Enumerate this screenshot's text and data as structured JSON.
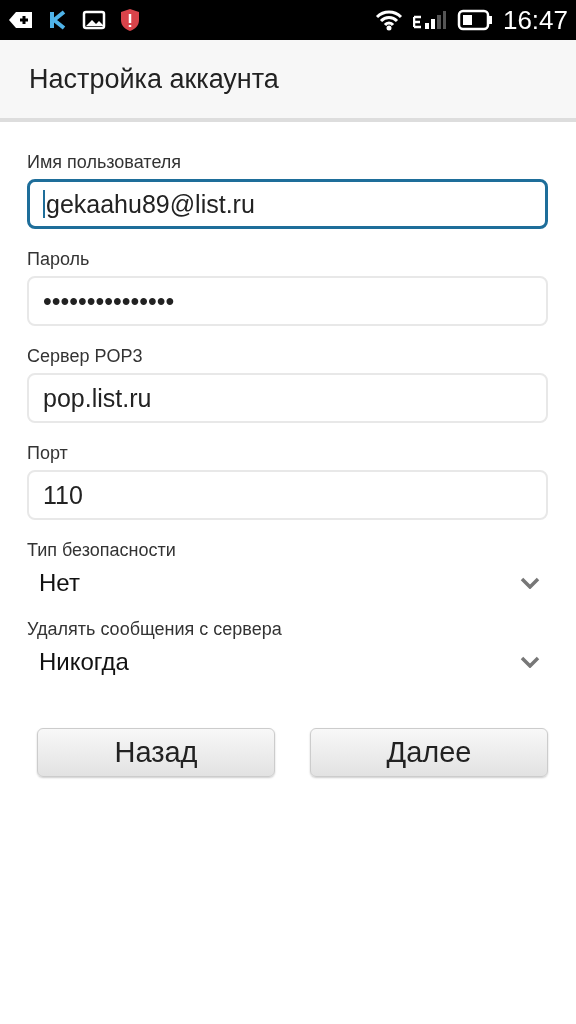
{
  "status_bar": {
    "time": "16:47"
  },
  "header": {
    "title": "Настройка аккаунта"
  },
  "fields": [
    {
      "kind": "text",
      "label": "Имя пользователя",
      "value": "gekaahu89@list.ru",
      "focused": true
    },
    {
      "kind": "text",
      "label": "Пароль",
      "value": "•••••••••••••••",
      "focused": false
    },
    {
      "kind": "text",
      "label": "Сервер POP3",
      "value": "pop.list.ru",
      "focused": false
    },
    {
      "kind": "text",
      "label": "Порт",
      "value": "110",
      "focused": false
    },
    {
      "kind": "dropdown",
      "label": "Тип безопасности",
      "value": "Нет"
    },
    {
      "kind": "dropdown",
      "label": "Удалять сообщения с сервера",
      "value": "Никогда"
    }
  ],
  "buttons": [
    "Назад",
    "Далее"
  ]
}
